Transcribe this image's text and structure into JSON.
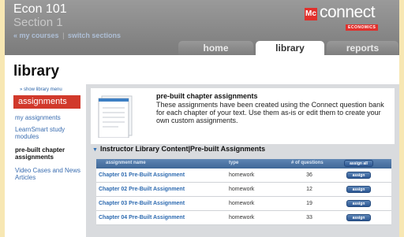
{
  "header": {
    "course": "Econ 101",
    "section": "Section 1",
    "links": [
      "« my courses",
      "switch sections"
    ],
    "logo_text": "connect",
    "logo_sub": "ECONOMICS"
  },
  "tabs": [
    {
      "label": "home",
      "active": false
    },
    {
      "label": "library",
      "active": true
    },
    {
      "label": "reports",
      "active": false
    }
  ],
  "page_title": "library",
  "sidebar": {
    "show_menu": "» show library menu",
    "items": [
      {
        "label": "assignments"
      },
      {
        "label": "my assignments"
      },
      {
        "label": "LearnSmart study modules"
      },
      {
        "label": "pre-built chapter assignments"
      },
      {
        "label": "Video Cases and News Articles"
      }
    ]
  },
  "info": {
    "title": "pre-built chapter assignments",
    "text": "These assignments have been created using the Connect question bank for each chapter of your text. Use them as-is or edit them to create your own custom assignments."
  },
  "section_title": "Instructor Library Content|Pre-built Assignments",
  "table": {
    "headers": {
      "name": "assignment name",
      "type": "type",
      "count": "# of questions"
    },
    "assign_all_label": "assign all",
    "assign_label": "assign",
    "rows": [
      {
        "name": "Chapter 01 Pre-Built Assignment",
        "type": "homework",
        "count": "36"
      },
      {
        "name": "Chapter 02 Pre-Built Assignment",
        "type": "homework",
        "count": "12"
      },
      {
        "name": "Chapter 03 Pre-Built Assignment",
        "type": "homework",
        "count": "19"
      },
      {
        "name": "Chapter 04 Pre-Built Assignment",
        "type": "homework",
        "count": "33"
      }
    ]
  },
  "colors": {
    "accent_red": "#d1392b",
    "link_blue": "#2d6ab0",
    "header_gray": "#8a8a8a",
    "table_header_blue": "#4a72a3"
  }
}
